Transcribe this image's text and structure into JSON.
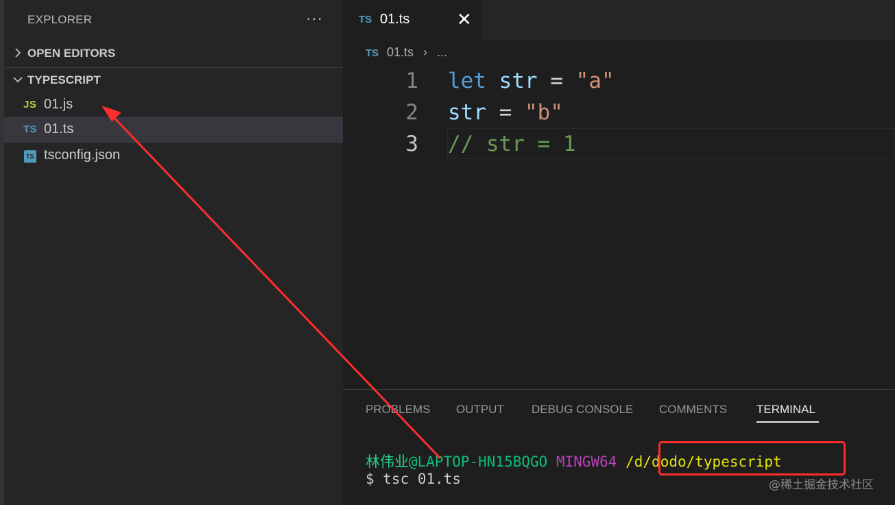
{
  "sidebar": {
    "title": "EXPLORER",
    "more_icon": "more-icon",
    "sections": {
      "open_editors": "OPEN EDITORS",
      "folder": "TYPESCRIPT"
    },
    "files": [
      {
        "icon_text": "JS",
        "name": "01.js"
      },
      {
        "icon_text": "TS",
        "name": "01.ts"
      },
      {
        "icon_text": "TS",
        "name": "tsconfig.json"
      }
    ]
  },
  "editor": {
    "tab": {
      "icon_text": "TS",
      "name": "01.ts",
      "close": "✕"
    },
    "breadcrumb": {
      "icon_text": "TS",
      "file": "01.ts",
      "separator": "›",
      "more": "..."
    },
    "lines": [
      {
        "number": "1",
        "tokens": [
          "let",
          " ",
          "str",
          " = ",
          "\"a\""
        ]
      },
      {
        "number": "2",
        "tokens": [
          "str",
          " = ",
          "\"b\""
        ]
      },
      {
        "number": "3",
        "tokens": [
          "// str = 1"
        ]
      }
    ]
  },
  "panel": {
    "tabs": [
      "PROBLEMS",
      "OUTPUT",
      "DEBUG CONSOLE",
      "COMMENTS",
      "TERMINAL"
    ],
    "active_tab": "TERMINAL",
    "terminal": {
      "user": "林伟业",
      "host": "@LAPTOP-HN15BQGO",
      "system": "MINGW64",
      "path": "/d/dodo/typescript",
      "command": "$ tsc 01.ts"
    }
  },
  "watermark": "@稀土掘金技术社区",
  "colors": {
    "annotation_red": "#ff2d2d",
    "keyword": "#569cd6",
    "variable": "#9cdcfe",
    "string": "#ce9178",
    "comment": "#6a9955"
  }
}
